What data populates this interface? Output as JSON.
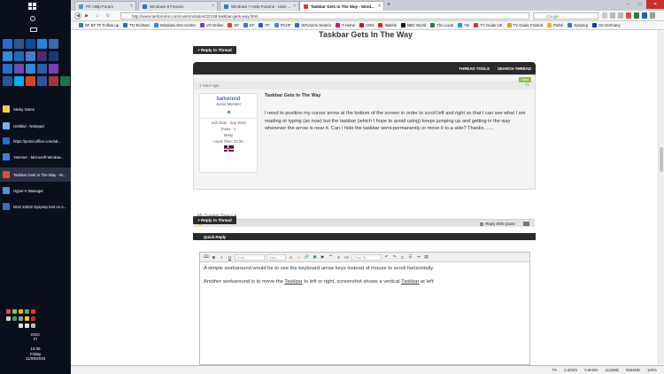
{
  "taskbar": {
    "items": [
      {
        "label": "Sticky Notes",
        "color": "#f2d23a"
      },
      {
        "label": "Untitled - Notepad",
        "color": "#7fb2e5"
      },
      {
        "label": "https://portal.office.com/ad...",
        "color": "#1e6fd6"
      },
      {
        "label": "Yammer - Microsoft Window...",
        "color": "#3c7fd8"
      },
      {
        "label": "Taskbar Gets In The Way - W...",
        "color": "#e04f2d"
      },
      {
        "label": "Hyper-V Manager",
        "color": "#5a8fcb"
      },
      {
        "label": "W10 10532 Sysprep test on A...",
        "color": "#3d6fb8"
      }
    ],
    "lang": "ENG",
    "lang_sub": "FI",
    "time": "10:35",
    "day": "Friday",
    "date": "11/09/2015"
  },
  "browser": {
    "tabs": [
      {
        "label": "PC Help Forum",
        "color": "#5b8fd6"
      },
      {
        "label": "Windows 8 Forums",
        "color": "#3b6db5"
      },
      {
        "label": "Windows 7 Help Forums - User ...",
        "color": "#2c7bd0"
      },
      {
        "label": "Taskbar Gets In The Way - Wind...",
        "color": "#d9392c"
      }
    ],
    "url": "http://www.tenforums.com/customization/22128-taskbar-gets-way.html",
    "search_placeholder": "Google",
    "bookmarks": [
      {
        "label": "SF EF TF Follow up",
        "color": "#3a78c9"
      },
      {
        "label": "TN TechNet",
        "color": "#2f6cb3"
      },
      {
        "label": "Windows Dev Center",
        "color": "#1f8fd8"
      },
      {
        "label": "VS Online",
        "color": "#7f3fbf"
      },
      {
        "label": "SF",
        "color": "#d24a2a"
      },
      {
        "label": "EF",
        "color": "#3a78c9"
      },
      {
        "label": "TF",
        "color": "#2b5fb0"
      },
      {
        "label": "PCHF",
        "color": "#4c8bd6"
      },
      {
        "label": "WForums Search",
        "color": "#2a6acb"
      },
      {
        "label": "T-Home",
        "color": "#e2007a"
      },
      {
        "label": "CNN",
        "color": "#c41a1a"
      },
      {
        "label": "Iltalehti",
        "color": "#d12a2a"
      },
      {
        "label": "BBC World",
        "color": "#111111"
      },
      {
        "label": "The Local",
        "color": "#2e7d32"
      },
      {
        "label": "Yle",
        "color": "#00a3e0"
      },
      {
        "label": "TV Guide UK",
        "color": "#d33"
      },
      {
        "label": "TV Guide Finland",
        "color": "#e0a21a"
      },
      {
        "label": "Pathé",
        "color": "#f2b400"
      },
      {
        "label": "Sysprep",
        "color": "#3a78c9"
      },
      {
        "label": "O2 Germany",
        "color": "#0b3a8a"
      }
    ],
    "status": {
      "zoom_status": "7%",
      "net": "0.4KB/s",
      "net2": "0.6KB/s",
      "mem": "4119MB",
      "mem2": "5564MB",
      "zoom": "100%"
    }
  },
  "forum": {
    "thread_title": "Taskbar Gets In The Way",
    "reply_label": "+ Reply to Thread",
    "thread_tools": "THREAD TOOLS",
    "search_thread": "SEARCH THREAD",
    "post": {
      "time": "1 Hour Ago",
      "number": "#1",
      "status_badge": "New",
      "username": "barkerend",
      "rank": "Junior Member",
      "join_date": "Join Date : Sep 2015",
      "posts": "Posts : 4",
      "location": "Many",
      "local_time": "Local Time: 02:28",
      "title": "Taskbar Gets In The Way",
      "body": "I need to position my cursor arrow at the bottom of the screen in order to scroll left and right so that I can see what I am reading or typing (as now) but the taskbar (which I hope to avoid using) keeps jumping up and getting in the way whenever the arrow is near it. Can I hide the taskbar semi-permanently or move it to a side? Thanks.......",
      "system_specs": "My System Specs",
      "reply_with_quote": "Reply With Quote"
    },
    "quick_reply": "Quick Reply",
    "editor": {
      "font_placeholder": "Font",
      "size_placeholder": "Size",
      "post_template": "Post Te...",
      "line1": "A simple workaround would be to use the keyboard arrow keys instead of mouse to scroll horizontally.",
      "line2_a": "Another workaround is to move the ",
      "line2_b": "Taskbar",
      "line2_c": " to left or right, screenshot shows a vertical ",
      "line2_d": "Taskbar",
      "line2_e": " at left:"
    }
  }
}
